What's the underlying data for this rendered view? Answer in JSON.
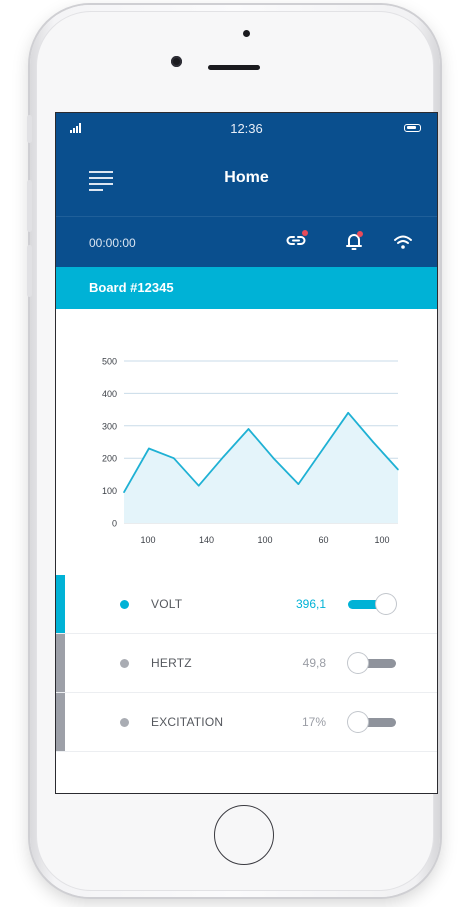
{
  "status_bar": {
    "time": "12:36"
  },
  "header": {
    "title": "Home",
    "timer": "00:00:00"
  },
  "board": {
    "title": "Board #12345"
  },
  "colors": {
    "header_bg": "#0a4f8e",
    "accent": "#00b2d6",
    "inactive": "#9a9da5",
    "notification": "#e84b5a"
  },
  "icons": [
    "signal-icon",
    "battery-icon",
    "menu-icon",
    "link-icon",
    "bell-icon",
    "wifi-icon"
  ],
  "chart_data": {
    "type": "area",
    "categories": [
      "100",
      "140",
      "100",
      "60",
      "100"
    ],
    "y_ticks": [
      "500",
      "400",
      "300",
      "200",
      "100",
      "0"
    ],
    "values": [
      95,
      230,
      200,
      115,
      205,
      290,
      200,
      120,
      230,
      340,
      250,
      165
    ],
    "ylim": [
      0,
      500
    ],
    "grid": true
  },
  "readings": [
    {
      "label": "VOLT",
      "value": "396,1",
      "active": true
    },
    {
      "label": "HERTZ",
      "value": "49,8",
      "active": false
    },
    {
      "label": "EXCITATION",
      "value": "17%",
      "active": false
    }
  ]
}
